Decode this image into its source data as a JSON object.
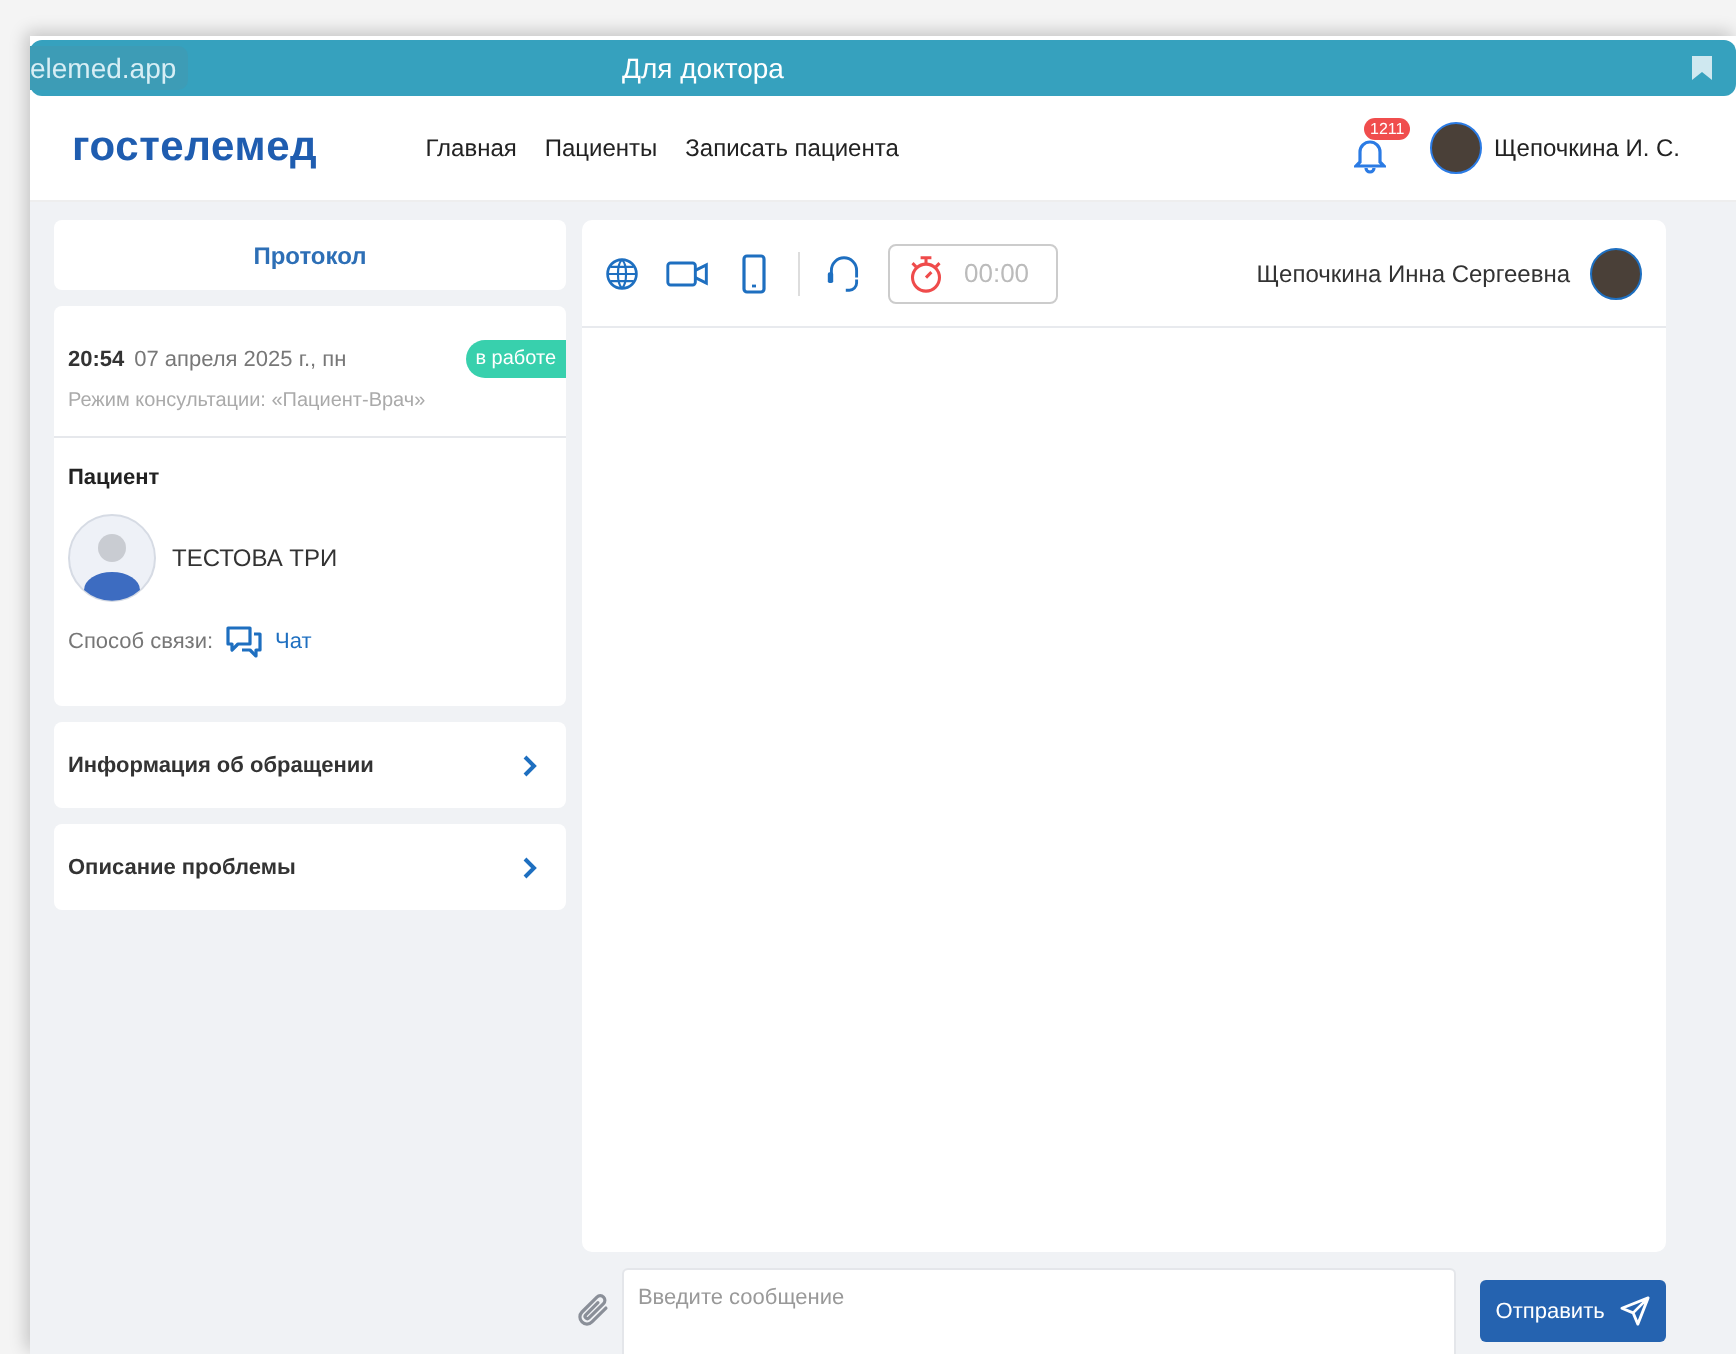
{
  "browser_bar": {
    "url": "elemed.app",
    "title": "Для доктора"
  },
  "header": {
    "logo": "гостелемед",
    "nav": [
      "Главная",
      "Пациенты",
      "Записать пациента"
    ],
    "notifications": {
      "count": "1211"
    },
    "user": {
      "name": "Щепочкина И. С."
    }
  },
  "sidebar": {
    "protocol_button": "Протокол",
    "session": {
      "time": "20:54",
      "date": "07 апреля 2025 г., пн",
      "status": "в работе",
      "mode": "Режим консультации: «Пациент-Врач»"
    },
    "patient": {
      "heading": "Пациент",
      "name": "ТЕСТОВА ТРИ",
      "contact_label": "Способ связи:",
      "contact_method": "Чат"
    },
    "sections": [
      {
        "title": "Информация об обращении",
        "expanded": false
      },
      {
        "title": "Описание проблемы",
        "expanded": false
      }
    ]
  },
  "chat": {
    "toolbar": {
      "timer": "00:00",
      "doctor_name": "Щепочкина Инна Сергеевна"
    },
    "input": {
      "placeholder": "Введите сообщение"
    },
    "send_button": "Отправить"
  }
}
